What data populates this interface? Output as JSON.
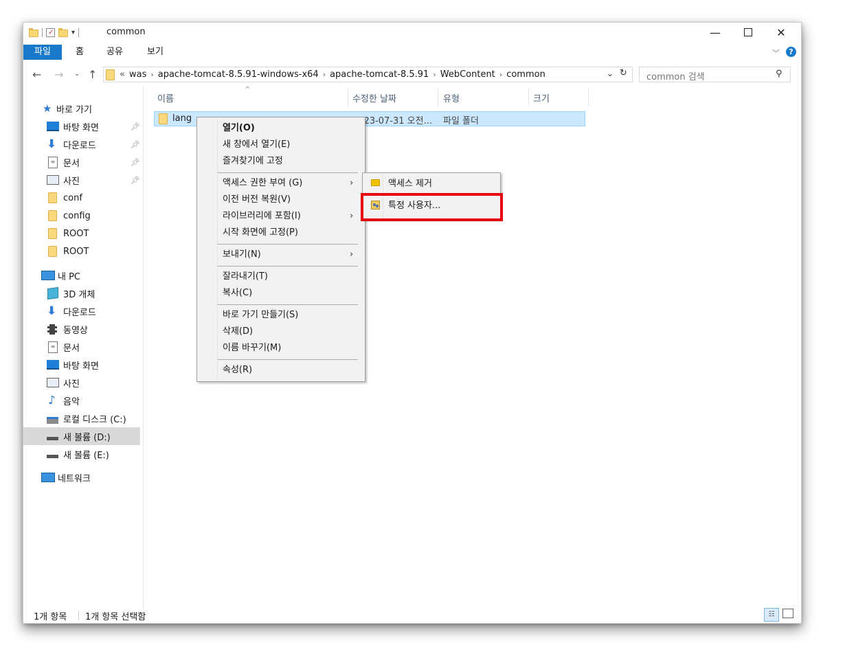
{
  "window": {
    "title": "common",
    "min_glyph": "—",
    "max_glyph": "☐",
    "close_glyph": "✕"
  },
  "ribbon": {
    "tabs": [
      "파일",
      "홈",
      "공유",
      "보기"
    ],
    "help_glyph": "?"
  },
  "address": {
    "overflow": "«",
    "crumbs": [
      "was",
      "apache-tomcat-8.5.91-windows-x64",
      "apache-tomcat-8.5.91",
      "WebContent",
      "common"
    ],
    "search_placeholder": "common 검색"
  },
  "sidebar": {
    "quick_access": "바로 가기",
    "items": [
      {
        "label": "바탕 화면",
        "icon": "desktop-icon",
        "pinned": true
      },
      {
        "label": "다운로드",
        "icon": "download-icon",
        "pinned": true
      },
      {
        "label": "문서",
        "icon": "document-icon",
        "pinned": true
      },
      {
        "label": "사진",
        "icon": "picture-icon",
        "pinned": true
      },
      {
        "label": "conf",
        "icon": "folder-icon"
      },
      {
        "label": "config",
        "icon": "folder-icon"
      },
      {
        "label": "ROOT",
        "icon": "folder-icon"
      },
      {
        "label": "ROOT",
        "icon": "folder-icon"
      }
    ],
    "this_pc": "내 PC",
    "pc_items": [
      {
        "label": "3D 개체",
        "icon": "3d-objects-icon"
      },
      {
        "label": "다운로드",
        "icon": "download-icon"
      },
      {
        "label": "동영상",
        "icon": "video-icon"
      },
      {
        "label": "문서",
        "icon": "document-icon"
      },
      {
        "label": "바탕 화면",
        "icon": "desktop-icon"
      },
      {
        "label": "사진",
        "icon": "picture-icon"
      },
      {
        "label": "음악",
        "icon": "music-icon"
      },
      {
        "label": "로컬 디스크 (C:)",
        "icon": "local-disk-icon"
      },
      {
        "label": "새 볼륨 (D:)",
        "icon": "drive-icon",
        "selected": true
      },
      {
        "label": "새 볼륨 (E:)",
        "icon": "drive-icon"
      }
    ],
    "network": "네트워크"
  },
  "columns": {
    "name": "이름",
    "date": "수정한 날짜",
    "type": "유형",
    "size": "크기"
  },
  "files": [
    {
      "name": "lang",
      "date": "2023-07-31 오전...",
      "type": "파일 폴더"
    }
  ],
  "context_menu": {
    "groups": [
      [
        "열기(O)",
        "새 창에서 열기(E)",
        "즐겨찾기에 고정"
      ],
      [
        "액세스 권한 부여 (G)",
        "이전 버전 복원(V)",
        "라이브러리에 포함(I)",
        "시작 화면에 고정(P)"
      ],
      [
        "보내기(N)"
      ],
      [
        "잘라내기(T)",
        "복사(C)"
      ],
      [
        "바로 가기 만들기(S)",
        "삭제(D)",
        "이름 바꾸기(M)"
      ],
      [
        "속성(R)"
      ]
    ],
    "submenu_glyph": "›"
  },
  "submenu": {
    "items": [
      "액세스 제거",
      "특정 사용자..."
    ]
  },
  "status": {
    "count": "1개 항목",
    "selected": "1개 항목 선택함"
  },
  "colors": {
    "file_tab": "#1979ca",
    "selection": "#cce8ff",
    "highlight": "#e8000b"
  }
}
